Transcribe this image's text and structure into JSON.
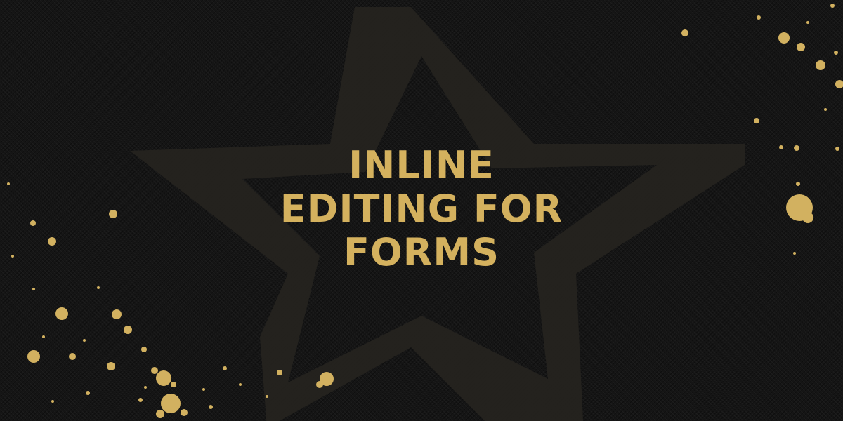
{
  "headline": {
    "lines": [
      "INLINE",
      "EDITING FOR",
      "FORMS"
    ]
  },
  "colors": {
    "background": "#151515",
    "text_gold": "#d4b15e",
    "splatter_gold": "#d2b160",
    "watermark": "#2a2822"
  },
  "decorations": {
    "watermark_icon": "star-icon",
    "splatter": "gold-paint-splatter"
  }
}
